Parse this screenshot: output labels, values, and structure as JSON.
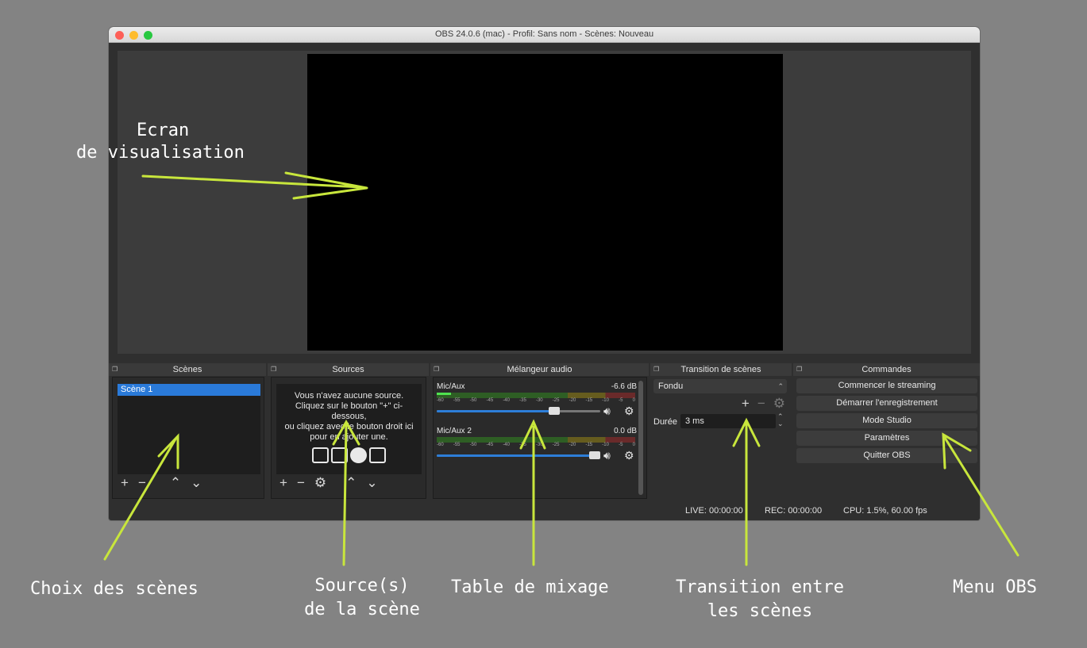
{
  "window": {
    "title": "OBS 24.0.6 (mac) - Profil: Sans nom - Scènes: Nouveau"
  },
  "docks": {
    "scenes": {
      "title": "Scènes",
      "items": [
        "Scène 1"
      ]
    },
    "sources": {
      "title": "Sources",
      "empty_line1": "Vous n'avez aucune source.",
      "empty_line2": "Cliquez sur le bouton \"+\" ci-",
      "empty_line3": "dessous,",
      "empty_line4": "ou cliquez avec le bouton droit ici",
      "empty_line5": "pour en ajouter une."
    },
    "mixer": {
      "title": "Mélangeur audio",
      "channels": [
        {
          "name": "Mic/Aux",
          "db": "-6.6 dB",
          "volume": 0.72,
          "level": 0.07
        },
        {
          "name": "Mic/Aux 2",
          "db": "0.0 dB",
          "volume": 1.0,
          "level": 0.0
        }
      ],
      "ticks": [
        "-60",
        "-55",
        "-50",
        "-45",
        "-40",
        "-35",
        "-30",
        "-25",
        "-20",
        "-15",
        "-10",
        "-5",
        "0"
      ]
    },
    "transitions": {
      "title": "Transition de scènes",
      "selected": "Fondu",
      "duration_label": "Durée",
      "duration_value": "3 ms"
    },
    "controls": {
      "title": "Commandes",
      "buttons": [
        "Commencer le streaming",
        "Démarrer l'enregistrement",
        "Mode Studio",
        "Paramètres",
        "Quitter OBS"
      ]
    }
  },
  "status": {
    "live": "LIVE: 00:00:00",
    "rec": "REC: 00:00:00",
    "cpu": "CPU: 1.5%, 60.00 fps"
  },
  "annotations": {
    "preview_line1": "Ecran",
    "preview_line2": "de visualisation",
    "scenes": "Choix des scènes",
    "sources_line1": "Source(s)",
    "sources_line2": "de la scène",
    "mixer": "Table de mixage",
    "transition_line1": "Transition entre",
    "transition_line2": "les scènes",
    "menu": "Menu OBS"
  },
  "colors": {
    "accent": "#c8e63c",
    "selection": "#2a7ad9",
    "background": "#838383"
  }
}
